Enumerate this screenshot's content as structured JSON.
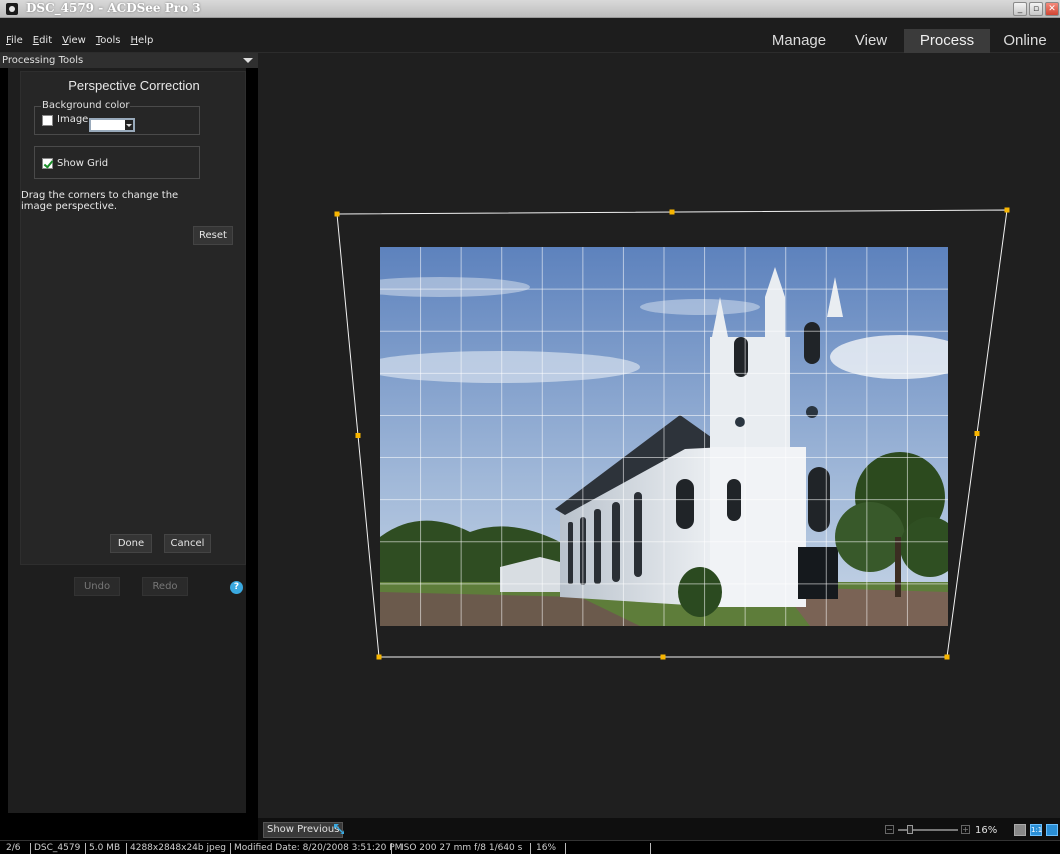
{
  "window": {
    "title": "DSC_4579 - ACDSee Pro 3",
    "buttons": [
      "_",
      "▫",
      "✕"
    ]
  },
  "menu": {
    "items": [
      "File",
      "Edit",
      "View",
      "Tools",
      "Help"
    ]
  },
  "modes": {
    "tabs": [
      "Manage",
      "View",
      "Process",
      "Online"
    ],
    "active": "Process"
  },
  "panel": {
    "header": "Processing Tools",
    "tool_title": "Perspective Correction",
    "background_group_label": "Background color",
    "image_checkbox_label": "Image",
    "image_checked": false,
    "show_grid_label": "Show Grid",
    "show_grid_checked": true,
    "instructions": "Drag the corners to change the image perspective.",
    "reset_label": "Reset",
    "done_label": "Done",
    "cancel_label": "Cancel",
    "undo_label": "Undo",
    "redo_label": "Redo",
    "help_glyph": "?"
  },
  "viewer": {
    "show_previous_label": "Show Previous",
    "zoom_minus": "−",
    "zoom_plus": "+",
    "zoom_value": "16%",
    "zoom_level_fraction": 0.16,
    "view_buttons": [
      "fit",
      "1:1",
      "expand"
    ]
  },
  "status": {
    "position": "2/6",
    "filename": "DSC_4579",
    "filesize": "5.0 MB",
    "dimensions": "4288x2848x24b jpeg",
    "modified": "Modified Date: 8/20/2008 3:51:20 PM",
    "exif": "ISO 200  27 mm  f/8  1/640 s",
    "zoom": "16%"
  },
  "colors": {
    "accent_handle": "#f7b500",
    "process_tab_bg": "#3b3b3b",
    "help_blue": "#3aa9e0"
  },
  "icons": {
    "app": "acdsee-app-icon",
    "help": "help-icon",
    "show_previous": "show-previous-icon",
    "dropdown": "chevron-down-icon"
  }
}
